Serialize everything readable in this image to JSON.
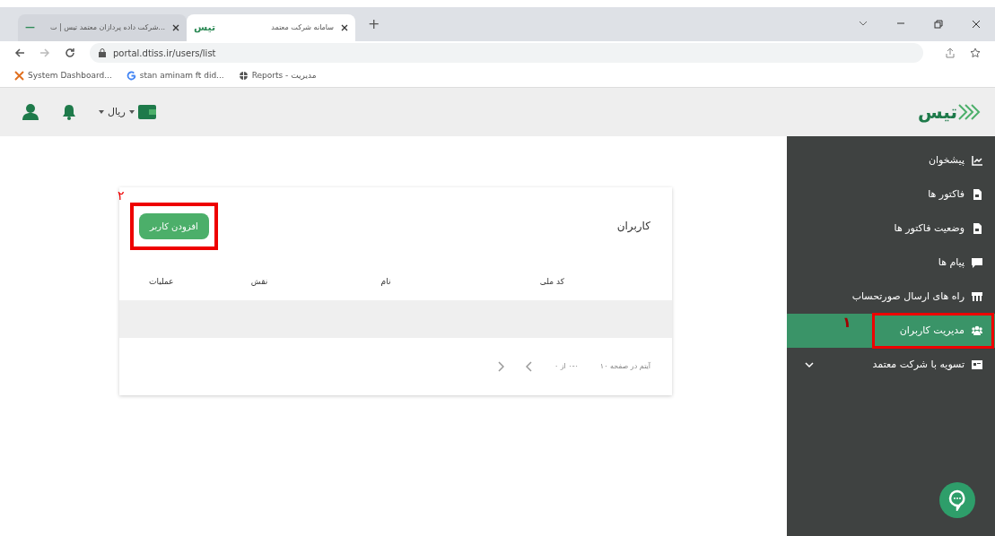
{
  "browser": {
    "tabs": [
      {
        "title": "سامانه شرکت معتمد",
        "favicon_text": "تیس",
        "selected": true
      },
      {
        "title": "شرکت داده پردازان معتمد تیس | ت...",
        "favicon_text": "—",
        "selected": false
      }
    ],
    "new_tab": "+",
    "url": "portal.dtiss.ir/users/list",
    "bookmarks": [
      {
        "label": "Reports - مدیریت",
        "kind": "globe"
      },
      {
        "label": "stan aminam ft did...",
        "kind": "g"
      },
      {
        "label": "System Dashboard...",
        "kind": "x"
      }
    ]
  },
  "header": {
    "currency": "ریال"
  },
  "logo": "تیس",
  "sidebar": {
    "items": [
      {
        "label": "پیشخوان",
        "kind": "chart",
        "selected": false,
        "has_submenu": false
      },
      {
        "label": "فاکتور ها",
        "kind": "file",
        "selected": false,
        "has_submenu": false
      },
      {
        "label": "وضعیت فاکتور ها",
        "kind": "file",
        "selected": false,
        "has_submenu": false
      },
      {
        "label": "پیام ها",
        "kind": "chat",
        "selected": false,
        "has_submenu": false
      },
      {
        "label": "راه های ارسال صورتحساب",
        "kind": "store",
        "selected": false,
        "has_submenu": false
      },
      {
        "label": "مدیریت کاربران",
        "kind": "users",
        "selected": true,
        "has_submenu": false,
        "annotation": "۱"
      },
      {
        "label": "تسویه با شرکت معتمد",
        "kind": "card",
        "selected": false,
        "has_submenu": true
      }
    ]
  },
  "card": {
    "title": "کاربران",
    "add_button": {
      "label": "افزودن کاربر",
      "annotation": "۲"
    },
    "columns": [
      "کد ملی",
      "نام",
      "نقش",
      "عملیات"
    ],
    "pagination": {
      "items_per_page": "آیتم در صفحه ۱۰",
      "range": "۰-۰ از ۰"
    }
  }
}
